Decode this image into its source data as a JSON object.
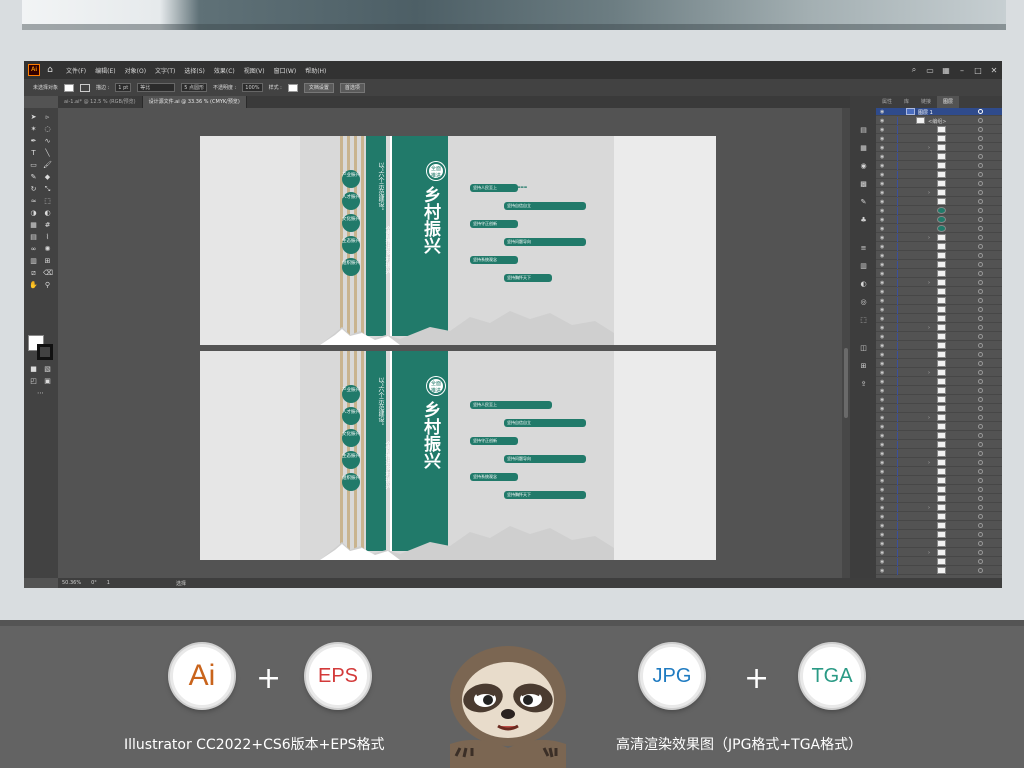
{
  "menubar": {
    "app_logo": "Ai",
    "home_icon": "home-icon",
    "items": [
      "文件(F)",
      "编辑(E)",
      "对象(O)",
      "文字(T)",
      "选择(S)",
      "效果(C)",
      "视图(V)",
      "窗口(W)",
      "帮助(H)"
    ]
  },
  "controlbar": {
    "selection": "未选择对象",
    "stroke_label": "描边 :",
    "stroke_value": "1 pt",
    "stroke_style": "等比",
    "brush": "5 点圆形",
    "opacity_label": "不透明度 :",
    "opacity_value": "100%",
    "style_label": "样式 :",
    "doc_setup": "文档设置",
    "prefs": "首选项"
  },
  "tabs": [
    {
      "label": "ai-1.ai* @ 12.5 % (RGB/预览)",
      "active": false
    },
    {
      "label": "设计源文件.ai @ 33.36 % (CMYK/预览)",
      "active": true
    }
  ],
  "layers_panel": {
    "tabs": [
      "属性",
      "库",
      "链接",
      "图层"
    ],
    "active_tab": "图层",
    "layer_name": "图层 1",
    "group_name": "<编组>"
  },
  "status": {
    "zoom": "50.36%",
    "rotation": "0°",
    "artboard": "1",
    "tool": "选择"
  },
  "artwork": {
    "seal_text": "全面推进",
    "main_title": "乡村振兴",
    "vertical_slogan_1": "以“六个示范建设”",
    "vertical_slogan_2": "全面推进乡村振兴",
    "circles": [
      "产业振兴",
      "人才振兴",
      "文化振兴",
      "生态振兴",
      "组织振兴"
    ],
    "tags": [
      "坚持人民至上",
      "坚持自信自立",
      "坚持守正创新",
      "坚持问题导向",
      "坚持系统观念",
      "坚持胸怀天下"
    ],
    "colors": {
      "primary": "#217a6a",
      "stripe": "#c9b48f"
    }
  },
  "bottom": {
    "badges": [
      {
        "text": "Ai",
        "color": "#c9641c"
      },
      {
        "text": "EPS",
        "color": "#d33a3a"
      },
      {
        "text": "JPG",
        "color": "#1f7bc1"
      },
      {
        "text": "TGA",
        "color": "#2a9a85"
      }
    ],
    "plus": "+",
    "caption_left": "Illustrator CC2022+CS6版本+EPS格式",
    "caption_right": "高清渲染效果图（JPG格式+TGA格式）"
  }
}
